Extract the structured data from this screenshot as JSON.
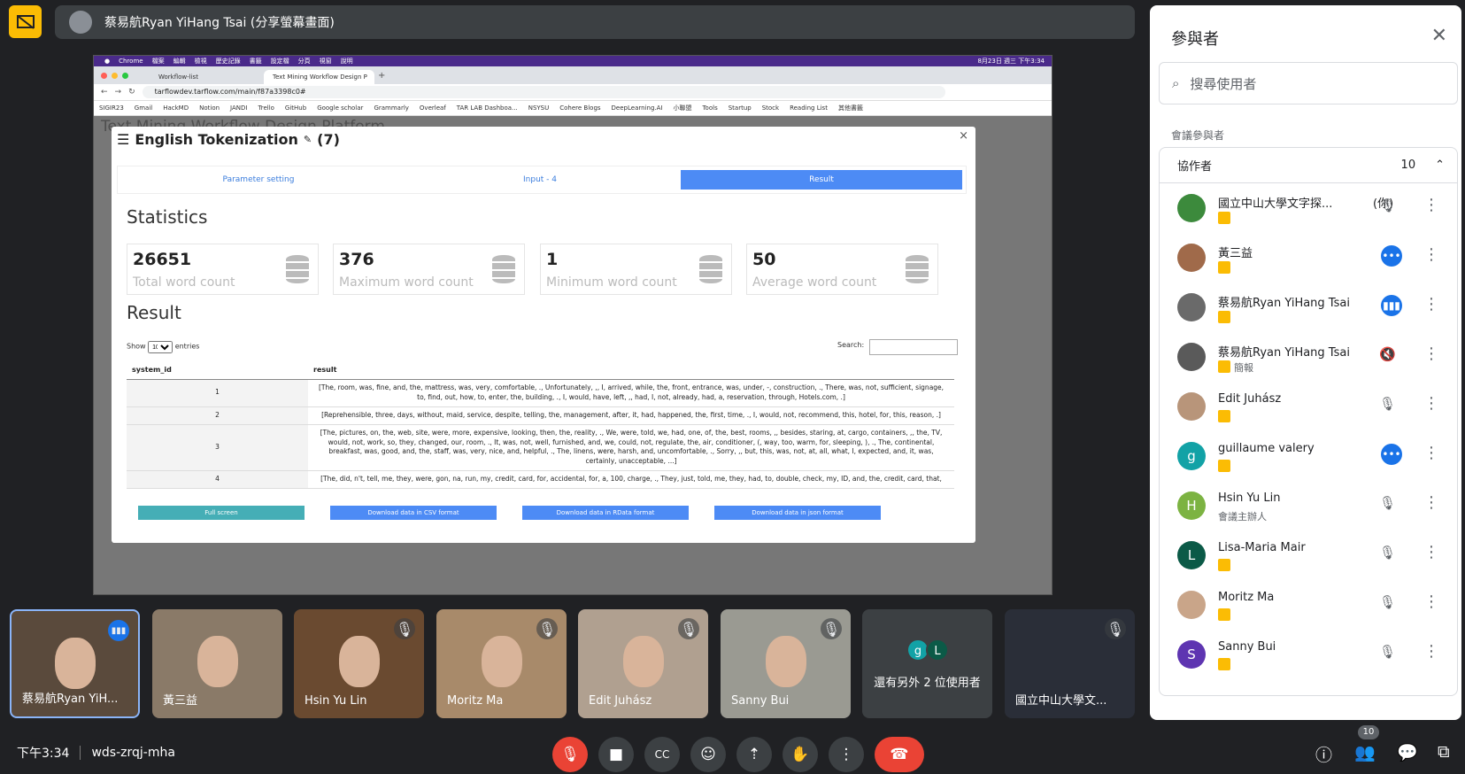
{
  "presenter": {
    "label": "蔡易航Ryan YiHang Tsai (分享螢幕畫面)"
  },
  "shared_screen": {
    "menu": [
      "Chrome",
      "檔案",
      "編輯",
      "檢視",
      "歷史記錄",
      "書籤",
      "設定檔",
      "分頁",
      "視窗",
      "說明"
    ],
    "clock": "8月23日 週三 下午3:34",
    "tabs": [
      "Workflow-list",
      "Text Mining Workflow Design P"
    ],
    "url": "tarflowdev.tarflow.com/main/f87a3398c0#",
    "bookmarks": [
      "SIGIR23",
      "Gmail",
      "HackMD",
      "Notion",
      "JANDI",
      "Trello",
      "GitHub",
      "Google scholar",
      "Grammarly",
      "Overleaf",
      "TAR LAB Dashboa...",
      "NSYSU",
      "Cohere Blogs",
      "DeepLearning.AI",
      "小聯盟",
      "Tools",
      "Startup",
      "Stock",
      "Reading List",
      "其他書籤"
    ],
    "bg_title": "Text Mining Workflow Design Platform",
    "modal": {
      "title": "English Tokenization",
      "count": "(7)",
      "tabs": [
        "Parameter setting",
        "Input - 4",
        "Result"
      ],
      "stats_heading": "Statistics",
      "stats": [
        {
          "value": "26651",
          "label": "Total word count"
        },
        {
          "value": "376",
          "label": "Maximum word count"
        },
        {
          "value": "1",
          "label": "Minimum word count"
        },
        {
          "value": "50",
          "label": "Average word count"
        }
      ],
      "result_heading": "Result",
      "show_label": "Show",
      "entries_value": "10",
      "entries_label": "entries",
      "search_label": "Search:",
      "columns": [
        "system_id",
        "result"
      ],
      "rows": [
        {
          "id": "1",
          "text": "[The, room, was, fine, and, the, mattress, was, very, comfortable, ., Unfortunately, ,, I, arrived, while, the, front, entrance, was, under, -, construction, ., There, was, not, sufficient, signage, to, find, out, how, to, enter, the, building, ., I, would, have, left, ,, had, I, not, already, had, a, reservation, through, Hotels.com, .]"
        },
        {
          "id": "2",
          "text": "[Reprehensible, three, days, without, maid, service, despite, telling, the, management, after, it, had, happened, the, first, time, ., I, would, not, recommend, this, hotel, for, this, reason, .]"
        },
        {
          "id": "3",
          "text": "[The, pictures, on, the, web, site, were, more, expensive, looking, then, the, reality, ., We, were, told, we, had, one, of, the, best, rooms, ,, besides, staring, at, cargo, containers, ,, the, TV, would, not, work, so, they, changed, our, room, ., It, was, not, well, furnished, and, we, could, not, regulate, the, air, conditioner, (, way, too, warm, for, sleeping, ), ., The, continental, breakfast, was, good, and, the, staff, was, very, nice, and, helpful, ., The, linens, were, harsh, and, uncomfortable, ., Sorry, ,, but, this, was, not, at, all, what, I, expected, and, it, was, certainly, unacceptable, ...]"
        },
        {
          "id": "4",
          "text": "[The, did, n't, tell, me, they, were, gon, na, run, my, credit, card, for, accidental, for, a, 100, charge, ., They, just, told, me, they, had, to, double, check, my, ID, and, the, credit, card, that,"
        }
      ],
      "buttons": [
        "Full screen",
        "Download data in CSV format",
        "Download data in RData format",
        "Download data in json format"
      ]
    }
  },
  "tiles": [
    {
      "name": "蔡易航Ryan YiH..."
    },
    {
      "name": "黃三益"
    },
    {
      "name": "Hsin Yu Lin"
    },
    {
      "name": "Moritz Ma"
    },
    {
      "name": "Edit Juhász"
    },
    {
      "name": "Sanny Bui"
    },
    {
      "name": "還有另外 2 位使用者",
      "g": "g",
      "l": "L"
    },
    {
      "name": "國立中山大學文..."
    }
  ],
  "bottom": {
    "time": "下午3:34",
    "meeting_code": "wds-zrqj-mha",
    "people_badge": "10"
  },
  "panel": {
    "title": "參與者",
    "search_placeholder": "搜尋使用者",
    "section": "會議參與者",
    "group_label": "協作者",
    "group_count": "10",
    "people": [
      {
        "name": "國立中山大學文字探...",
        "you": "(你)",
        "role": "",
        "avatar": "",
        "color": "#3c8a3c"
      },
      {
        "name": "黃三益",
        "role": "",
        "avatar": "",
        "color": "#a06a4a"
      },
      {
        "name": "蔡易航Ryan YiHang Tsai",
        "role": "",
        "avatar": "",
        "color": "#6a6a6a"
      },
      {
        "name": "蔡易航Ryan YiHang Tsai",
        "role": "簡報",
        "avatar": "",
        "color": "#5a5a5a"
      },
      {
        "name": "Edit Juhász",
        "role": "",
        "avatar": "",
        "color": "#b8957a"
      },
      {
        "name": "guillaume valery",
        "role": "",
        "avatar": "g",
        "color": "#12a2a6"
      },
      {
        "name": "Hsin Yu Lin",
        "role": "會議主辦人",
        "avatar": "H",
        "color": "#7cb342"
      },
      {
        "name": "Lisa-Maria Mair",
        "role": "",
        "avatar": "L",
        "color": "#0b5a47"
      },
      {
        "name": "Moritz Ma",
        "role": "",
        "avatar": "",
        "color": "#c9a589"
      },
      {
        "name": "Sanny Bui",
        "role": "",
        "avatar": "S",
        "color": "#5e35b1"
      }
    ]
  },
  "colors": {
    "accent": "#1a73e8",
    "danger": "#ea4335",
    "warning": "#fbbc04"
  }
}
